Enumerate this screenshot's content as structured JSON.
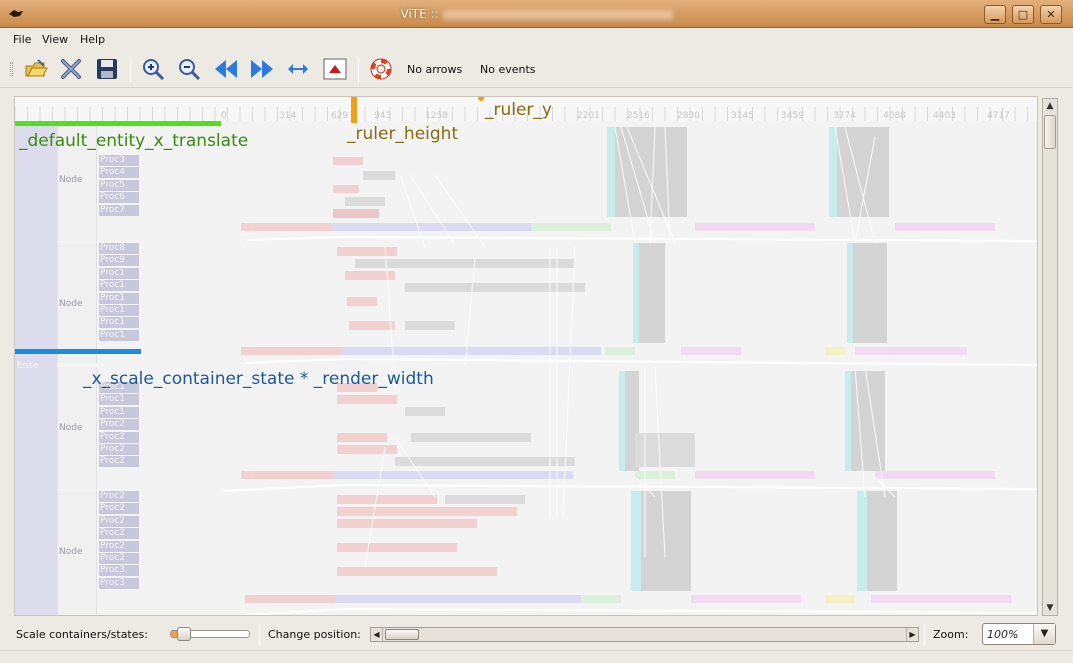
{
  "window": {
    "title": "ViTE ::",
    "minimize": "▁",
    "maximize": "□",
    "close": "✕"
  },
  "menu": {
    "file": "File",
    "view": "View",
    "help": "Help"
  },
  "toolbar": {
    "icons": [
      "open-folder-icon",
      "close-icon",
      "save-icon",
      "zoom-in-icon",
      "zoom-out-icon",
      "rewind-icon",
      "fast-forward-icon",
      "horizontal-arrows-icon",
      "reset-view-icon",
      "help-lifebuoy-icon"
    ],
    "no_arrows": "No arrows",
    "no_events": "No events"
  },
  "ruler": {
    "ticks": [
      "0",
      "314",
      "629",
      "943",
      "1258",
      "2201",
      "2516",
      "2830",
      "3145",
      "3459",
      "3774",
      "4088",
      "4403",
      "4717"
    ]
  },
  "trace": {
    "root_label": "Ense",
    "nodes": [
      {
        "label": "Node",
        "procs": [
          "Proc3",
          "Proc4",
          "Proc5",
          "Proc6",
          "Proc7"
        ]
      },
      {
        "label": "Node",
        "procs": [
          "Proc8",
          "Proc9",
          "Proc1",
          "Proc1",
          "Proc1",
          "Proc1",
          "Proc1",
          "Proc1"
        ]
      },
      {
        "label": "Node",
        "procs": [
          "Proc1",
          "Proc1",
          "Proc1",
          "Proc2",
          "Proc2",
          "Proc2",
          "Proc2"
        ]
      },
      {
        "label": "Node",
        "procs": [
          "Proc2",
          "Proc2",
          "Proc2",
          "Proc2",
          "Proc2",
          "Proc2",
          "Proc3",
          "Proc3"
        ]
      }
    ]
  },
  "annotations": {
    "default_entity": "_default_entity_x_translate",
    "ruler_height": "_ruler_height",
    "ruler_y": "_ruler_y",
    "x_scale": "_x_scale_container_state * _render_width",
    "colors": {
      "green": "#55dd22",
      "orange": "#f0a010",
      "blue": "#1a8ce0",
      "green_text": "#3a8a10",
      "orange_text": "#8a6a10",
      "blue_text": "#1a5a9a"
    }
  },
  "bottom": {
    "scale_label": "Scale containers/states:",
    "position_label": "Change position:",
    "zoom_label": "Zoom:",
    "zoom_value": "100%"
  }
}
